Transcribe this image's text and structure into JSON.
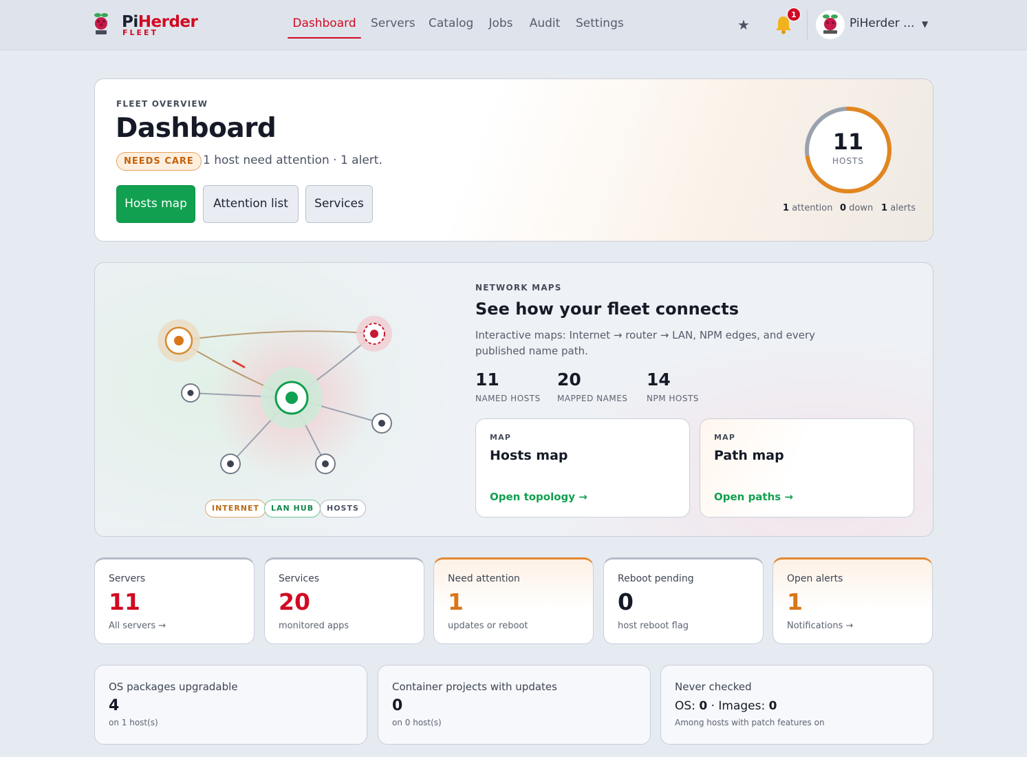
{
  "app": {
    "title_pi": "Pi",
    "title_herder": "Herder",
    "subtitle": "FLEET",
    "colors": {
      "brand_red": "#d10a22",
      "accent_green": "#11a04f",
      "warn_orange": "#e3872f"
    }
  },
  "nav": {
    "items": [
      {
        "label": "Dashboard",
        "active": true
      },
      {
        "label": "Servers"
      },
      {
        "label": "Catalog"
      },
      {
        "label": "Jobs"
      },
      {
        "label": "Audit"
      },
      {
        "label": "Settings"
      }
    ],
    "notifications_count": "1",
    "user_name": "PiHerder ...",
    "icons": [
      "star-icon",
      "bell-icon",
      "chevron-down-icon"
    ]
  },
  "hero": {
    "eyebrow": "FLEET OVERVIEW",
    "title": "Dashboard",
    "status_badge": "NEEDS CARE",
    "status_text": "1 host need attention · 1 alert.",
    "buttons": {
      "hosts_map": "Hosts map",
      "attention_list": "Attention list",
      "services": "Services"
    },
    "ring": {
      "value": "11",
      "label": "HOSTS",
      "attention_fraction": 0.72,
      "stats": [
        {
          "value": "1",
          "label": "attention"
        },
        {
          "value": "0",
          "label": "down"
        },
        {
          "value": "1",
          "label": "alerts"
        }
      ]
    }
  },
  "network": {
    "eyebrow": "NETWORK MAPS",
    "title": "See how your fleet connects",
    "description": "Interactive maps: Internet → router → LAN, NPM edges, and every published name path.",
    "stats": [
      {
        "value": "11",
        "label": "NAMED HOSTS"
      },
      {
        "value": "20",
        "label": "MAPPED NAMES"
      },
      {
        "value": "14",
        "label": "NPM HOSTS"
      }
    ],
    "legend": {
      "internet": "INTERNET",
      "lan_hub": "LAN HUB",
      "hosts": "HOSTS"
    },
    "maps": [
      {
        "eyebrow": "MAP",
        "title": "Hosts map",
        "link": "Open topology →"
      },
      {
        "eyebrow": "MAP",
        "title": "Path map",
        "link": "Open paths →"
      }
    ]
  },
  "tiles": [
    {
      "label": "Servers",
      "value": "11",
      "sub": "All servers →",
      "color": "#d10a22"
    },
    {
      "label": "Services",
      "value": "20",
      "sub": "monitored apps",
      "color": "#d10a22"
    },
    {
      "label": "Need attention",
      "value": "1",
      "sub": "updates or reboot",
      "color": "#d9761a"
    },
    {
      "label": "Reboot pending",
      "value": "0",
      "sub": "host reboot flag",
      "color": "#151a26"
    },
    {
      "label": "Open alerts",
      "value": "1",
      "sub": "Notifications →",
      "color": "#d9761a"
    }
  ],
  "patches": [
    {
      "label": "OS packages upgradable",
      "value": "4",
      "sub": "on 1 host(s)"
    },
    {
      "label": "Container projects with updates",
      "value": "0",
      "sub": "on 0 host(s)"
    },
    {
      "label": "Never checked",
      "os_label": "OS:",
      "os_value": "0",
      "images_label": "· Images:",
      "images_value": "0",
      "sub": "Among hosts with patch features on"
    }
  ]
}
